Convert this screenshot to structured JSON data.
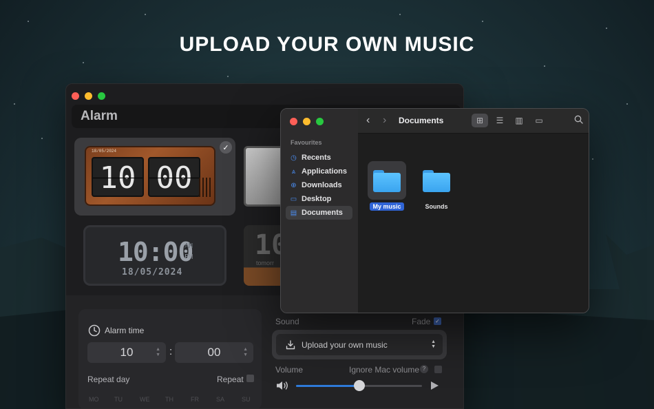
{
  "headline": "UPLOAD YOUR OWN MUSIC",
  "alarm_window": {
    "title": "Alarm",
    "flip_clock": {
      "date": "18/05/2024",
      "hours": "10",
      "minutes": "00"
    },
    "digital_clock": {
      "time": "10:00",
      "am": "AM",
      "pm": "PM",
      "date": "18/05/2024"
    },
    "peek_clock": {
      "number": "10",
      "sub": "tomorr"
    },
    "alarm_time": {
      "label": "Alarm time",
      "hour": "10",
      "minute": "00",
      "separator": ":"
    },
    "repeat_day_label": "Repeat day",
    "repeat_label": "Repeat",
    "days": [
      "MO",
      "TU",
      "WE",
      "TH",
      "FR",
      "SA",
      "SU"
    ],
    "sound": {
      "label": "Sound",
      "fade_label": "Fade",
      "fade_checked": true,
      "upload_label": "Upload your own music",
      "volume_label": "Volume",
      "ignore_label": "Ignore Mac volume",
      "ignore_checked": false,
      "help_text": "?",
      "volume_level": 0.5
    }
  },
  "finder": {
    "favourites_label": "Favourites",
    "sidebar": [
      {
        "label": "Recents",
        "icon": "clock-icon"
      },
      {
        "label": "Applications",
        "icon": "applications-icon"
      },
      {
        "label": "Downloads",
        "icon": "download-icon"
      },
      {
        "label": "Desktop",
        "icon": "desktop-icon"
      },
      {
        "label": "Documents",
        "icon": "document-icon",
        "active": true
      }
    ],
    "path_title": "Documents",
    "files": [
      {
        "name": "My music",
        "selected": true
      },
      {
        "name": "Sounds",
        "selected": false
      }
    ]
  },
  "colors": {
    "accent": "#2f7bd9",
    "selection": "#2f64d6",
    "folder": "#4fb5f8"
  }
}
